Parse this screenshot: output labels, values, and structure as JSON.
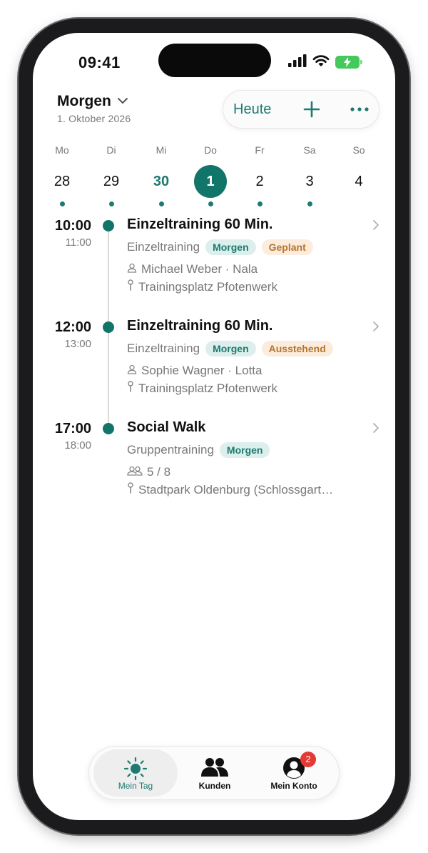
{
  "status_bar": {
    "time": "09:41"
  },
  "header": {
    "title": "Morgen",
    "date": "1. Oktober 2026",
    "today_button": "Heute"
  },
  "week": [
    {
      "name": "Mo",
      "num": "28",
      "style": "normal",
      "has_dot": true
    },
    {
      "name": "Di",
      "num": "29",
      "style": "normal",
      "has_dot": true
    },
    {
      "name": "Mi",
      "num": "30",
      "style": "today",
      "has_dot": true
    },
    {
      "name": "Do",
      "num": "1",
      "style": "selected",
      "has_dot": true
    },
    {
      "name": "Fr",
      "num": "2",
      "style": "normal",
      "has_dot": true
    },
    {
      "name": "Sa",
      "num": "3",
      "style": "normal",
      "has_dot": true
    },
    {
      "name": "So",
      "num": "4",
      "style": "normal",
      "has_dot": false
    }
  ],
  "events": [
    {
      "start": "10:00",
      "end": "11:00",
      "title": "Einzeltraining 60 Min.",
      "type": "Einzeltraining",
      "tags": [
        {
          "label": "Morgen",
          "color": "teal"
        },
        {
          "label": "Geplant",
          "color": "orange"
        }
      ],
      "person_icon": "person-icon",
      "person": "Michael Weber · Nala",
      "location": "Trainingsplatz Pfotenwerk"
    },
    {
      "start": "12:00",
      "end": "13:00",
      "title": "Einzeltraining 60 Min.",
      "type": "Einzeltraining",
      "tags": [
        {
          "label": "Morgen",
          "color": "teal"
        },
        {
          "label": "Ausstehend",
          "color": "orange"
        }
      ],
      "person_icon": "person-icon",
      "person": "Sophie Wagner · Lotta",
      "location": "Trainingsplatz Pfotenwerk"
    },
    {
      "start": "17:00",
      "end": "18:00",
      "title": "Social Walk",
      "type": "Gruppentraining",
      "tags": [
        {
          "label": "Morgen",
          "color": "teal"
        }
      ],
      "person_icon": "group-icon",
      "person": "5 / 8",
      "location": "Stadtpark Oldenburg (Schlossgart…"
    }
  ],
  "tabbar": {
    "tabs": [
      {
        "label": "Mein Tag",
        "icon": "sun-icon",
        "active": true
      },
      {
        "label": "Kunden",
        "icon": "people-icon",
        "active": false
      },
      {
        "label": "Mein Konto",
        "icon": "account-icon",
        "active": false,
        "badge": "2"
      }
    ]
  },
  "colors": {
    "accent": "#12756a",
    "accent_text": "#1e7a70",
    "tag_teal_bg": "#dcefec",
    "tag_orange_bg": "#fbecdd",
    "tag_orange_text": "#b8752b",
    "badge": "#e53935"
  }
}
